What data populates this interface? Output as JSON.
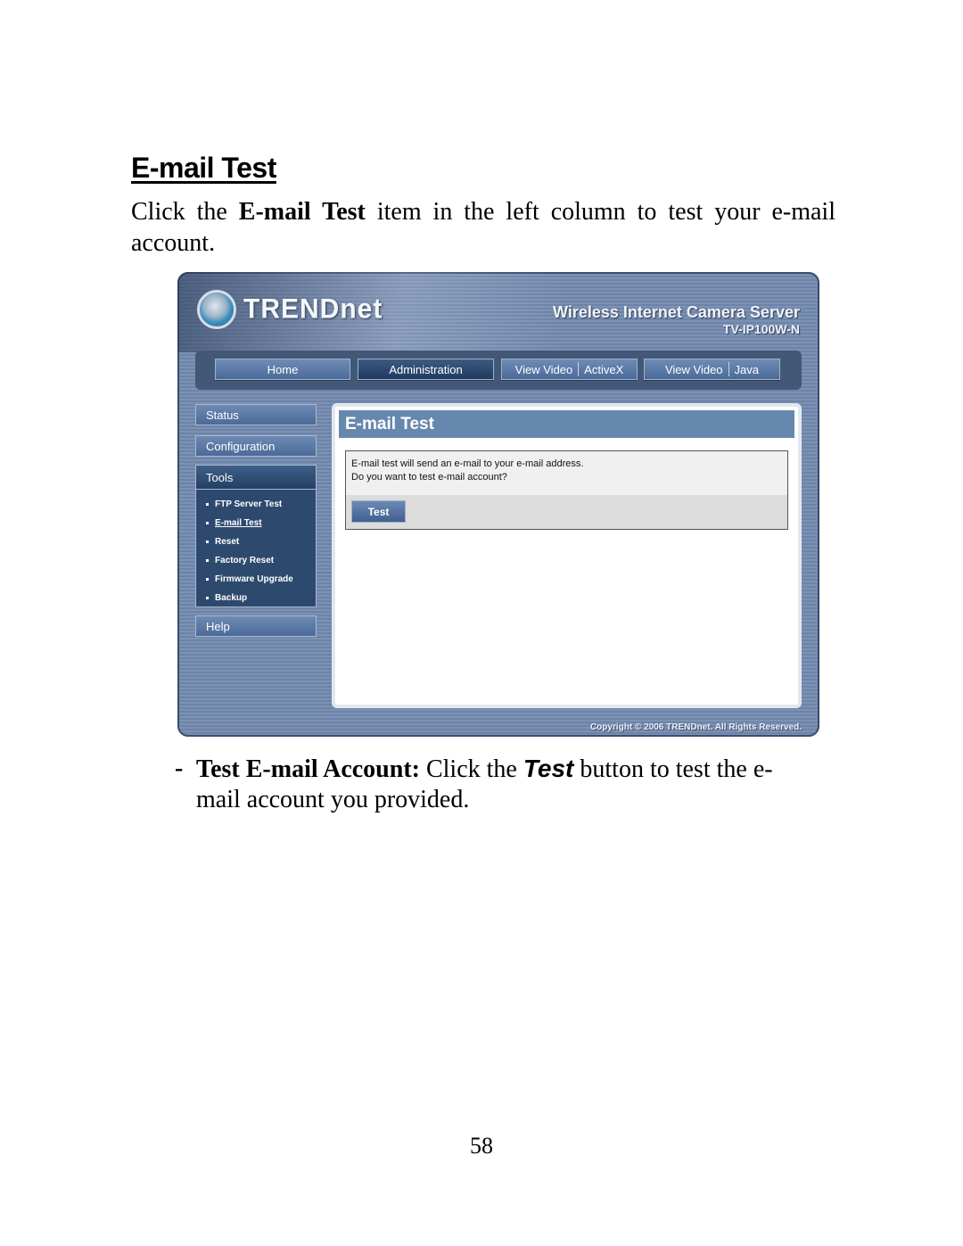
{
  "section": {
    "title": "E-mail Test",
    "intro_pre": "Click the ",
    "intro_bold": "E-mail Test",
    "intro_post": " item in the left column to test your e-mail account."
  },
  "screenshot": {
    "logo_text": "TRENDnet",
    "product_title": "Wireless Internet Camera Server",
    "product_model": "TV-IP100W-N",
    "nav": {
      "home": "Home",
      "administration": "Administration",
      "view_video_activex_a": "View Video",
      "view_video_activex_b": "ActiveX",
      "view_video_java_a": "View Video",
      "view_video_java_b": "Java",
      "active": "Administration"
    },
    "sidebar": {
      "status": "Status",
      "configuration": "Configuration",
      "tools": "Tools",
      "tools_items": [
        "FTP Server Test",
        "E-mail Test",
        "Reset",
        "Factory Reset",
        "Firmware Upgrade",
        "Backup"
      ],
      "current_item": "E-mail Test",
      "help": "Help"
    },
    "content": {
      "title": "E-mail Test",
      "message_line1": "E-mail test will send an e-mail to your e-mail address.",
      "message_line2": "Do you want to test e-mail account?",
      "test_button": "Test"
    },
    "copyright": "Copyright © 2006 TRENDnet. All Rights Reserved."
  },
  "bullet": {
    "dash": "-",
    "bold": "Test E-mail Account:",
    "pre": " Click the ",
    "italic": "Test",
    "post": " button to test the e-mail account you provided."
  },
  "page_number": "58"
}
